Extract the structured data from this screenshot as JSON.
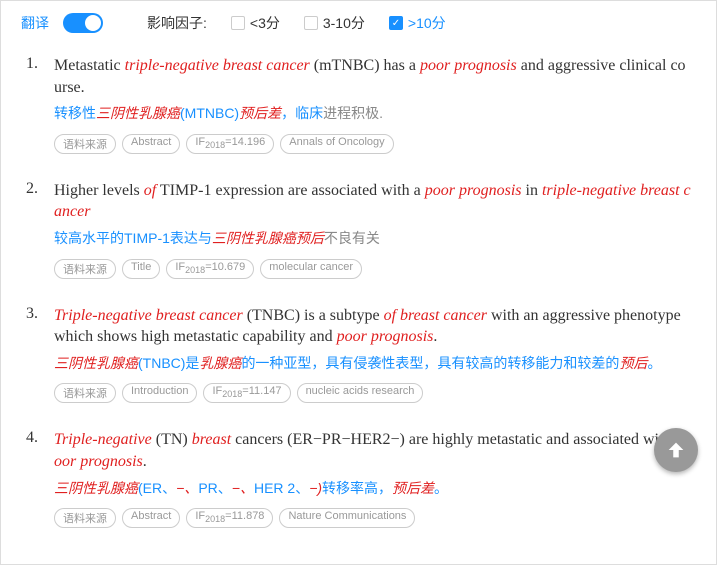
{
  "topbar": {
    "translate_label": "翻译",
    "factor_label": "影响因子:",
    "filters": [
      {
        "label": "<3分",
        "checked": false
      },
      {
        "label": "3-10分",
        "checked": false
      },
      {
        "label": ">10分",
        "checked": true
      }
    ]
  },
  "entries": [
    {
      "num": "1.",
      "en_parts": [
        {
          "t": "Metastatic ",
          "c": "n"
        },
        {
          "t": "triple-negative breast cancer",
          "c": "r"
        },
        {
          "t": " (mTNBC) has a ",
          "c": "n"
        },
        {
          "t": "poor prognosis",
          "c": "r"
        },
        {
          "t": " and aggressive clinical course.",
          "c": "n"
        }
      ],
      "zh_parts": [
        {
          "t": "转移性",
          "c": "b"
        },
        {
          "t": "三阴性乳腺癌",
          "c": "r"
        },
        {
          "t": "(MTNBC)",
          "c": "b"
        },
        {
          "t": "预后差",
          "c": "r"
        },
        {
          "t": "，临床",
          "c": "b"
        },
        {
          "t": "进程积极.",
          "c": "g"
        }
      ],
      "tags": [
        "语料来源",
        "Abstract",
        "IF|2018|=14.196",
        "Annals of Oncology"
      ]
    },
    {
      "num": "2.",
      "en_parts": [
        {
          "t": "Higher levels ",
          "c": "n"
        },
        {
          "t": "of",
          "c": "r"
        },
        {
          "t": " TIMP-1 expression are associated with a ",
          "c": "n"
        },
        {
          "t": "poor prognosis",
          "c": "r"
        },
        {
          "t": " in ",
          "c": "n"
        },
        {
          "t": "triple-negative breast cancer",
          "c": "r"
        }
      ],
      "zh_parts": [
        {
          "t": "较高水平的TIMP-1表达与",
          "c": "b"
        },
        {
          "t": "三阴性乳腺癌预后",
          "c": "r"
        },
        {
          "t": "不良有关",
          "c": "g"
        }
      ],
      "tags": [
        "语料来源",
        "Title",
        "IF|2018|=10.679",
        "molecular cancer"
      ]
    },
    {
      "num": "3.",
      "en_parts": [
        {
          "t": "Triple-negative breast cancer",
          "c": "r"
        },
        {
          "t": " (TNBC) is a subtype ",
          "c": "n"
        },
        {
          "t": "of breast cancer",
          "c": "r"
        },
        {
          "t": " with an aggressive phenotype which shows high metastatic capability and ",
          "c": "n"
        },
        {
          "t": "poor prognosis",
          "c": "r"
        },
        {
          "t": ".",
          "c": "n"
        }
      ],
      "zh_parts": [
        {
          "t": "三阴性乳腺癌",
          "c": "r"
        },
        {
          "t": "(TNBC)是",
          "c": "b"
        },
        {
          "t": "乳腺癌",
          "c": "r"
        },
        {
          "t": "的一种亚型，具有侵袭性表型，具有较高的转移能力和较差的",
          "c": "b"
        },
        {
          "t": "预后",
          "c": "r"
        },
        {
          "t": "。",
          "c": "b"
        }
      ],
      "tags": [
        "语料来源",
        "Introduction",
        "IF|2018|=11.147",
        "nucleic acids research"
      ]
    },
    {
      "num": "4.",
      "en_parts": [
        {
          "t": "Triple-negative",
          "c": "r"
        },
        {
          "t": " (TN) ",
          "c": "n"
        },
        {
          "t": "breast",
          "c": "r"
        },
        {
          "t": " cancers (ER−PR−HER2−) are highly metastatic and associated with ",
          "c": "n"
        },
        {
          "t": "poor prognosis",
          "c": "r"
        },
        {
          "t": ".",
          "c": "n"
        }
      ],
      "zh_parts": [
        {
          "t": "三阴性乳腺癌",
          "c": "r"
        },
        {
          "t": "(ER、",
          "c": "b"
        },
        {
          "t": "−、",
          "c": "r"
        },
        {
          "t": "PR、",
          "c": "b"
        },
        {
          "t": "−、",
          "c": "r"
        },
        {
          "t": "HER 2、",
          "c": "b"
        },
        {
          "t": "−)",
          "c": "r"
        },
        {
          "t": "转移率高，",
          "c": "b"
        },
        {
          "t": "预后差",
          "c": "r"
        },
        {
          "t": "。",
          "c": "b"
        }
      ],
      "tags": [
        "语料来源",
        "Abstract",
        "IF|2018|=11.878",
        "Nature Communications"
      ]
    }
  ]
}
